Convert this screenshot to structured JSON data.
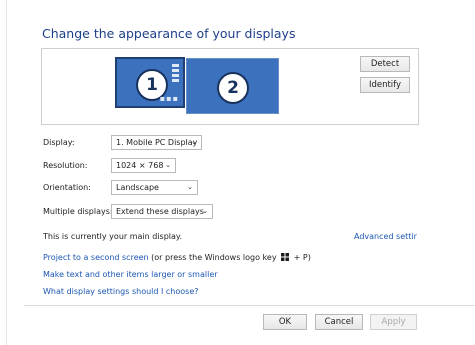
{
  "title": "Change the appearance of your displays",
  "preview": {
    "monitor1_number": "1",
    "monitor2_number": "2",
    "detect_label": "Detect",
    "identify_label": "Identify"
  },
  "settings": {
    "display": {
      "label": "Display:",
      "value": "1. Mobile PC Display"
    },
    "resolution": {
      "label": "Resolution:",
      "value": "1024 × 768"
    },
    "orientation": {
      "label": "Orientation:",
      "value": "Landscape"
    },
    "multiple_displays": {
      "label": "Multiple displays:",
      "value": "Extend these displays"
    }
  },
  "main_display_text": "This is currently your main display.",
  "advanced_settings_link": "Advanced settings",
  "project_link": "Project to a second screen",
  "project_suffix_pre": "(or press the Windows logo key",
  "project_suffix_post": "+ P)",
  "larger_link": "Make text and other items larger or smaller",
  "help_link": "What display settings should I choose?",
  "footer": {
    "ok": "OK",
    "cancel": "Cancel",
    "apply": "Apply"
  },
  "colors": {
    "accent": "#1e3f8a",
    "link": "#1c57b3",
    "monitor": "#3c71be"
  },
  "icons": [
    "chevron-down-icon",
    "windows-logo-icon"
  ]
}
